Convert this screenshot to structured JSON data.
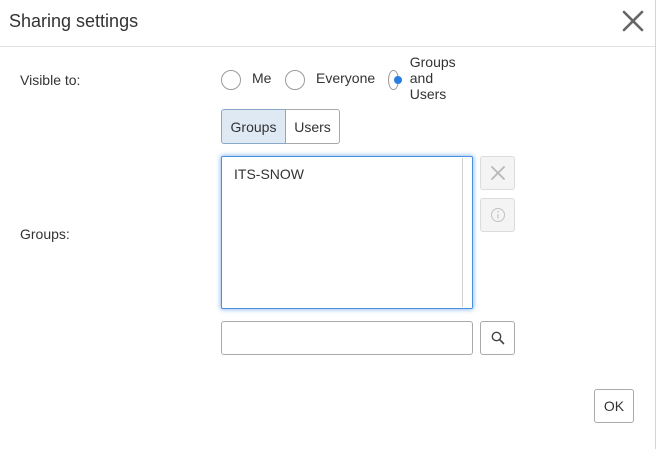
{
  "dialog": {
    "title": "Sharing settings"
  },
  "visibility": {
    "label": "Visible to:",
    "options": [
      {
        "label": "Me",
        "checked": false
      },
      {
        "label": "Everyone",
        "checked": false
      },
      {
        "label": "Groups and Users",
        "checked": true
      }
    ]
  },
  "tabs": {
    "groups_label": "Groups",
    "users_label": "Users",
    "active": "Groups"
  },
  "groups": {
    "label": "Groups:",
    "items": [
      "ITS-SNOW"
    ]
  },
  "search": {
    "value": "",
    "placeholder": ""
  },
  "footer": {
    "ok_label": "OK"
  },
  "colors": {
    "accent": "#2a7de1",
    "focus_border": "#4a90e2",
    "active_tab": "#dfe9f4"
  },
  "icons": {
    "close": "close-icon",
    "remove": "x-icon",
    "info": "info-icon",
    "search": "search-icon"
  }
}
